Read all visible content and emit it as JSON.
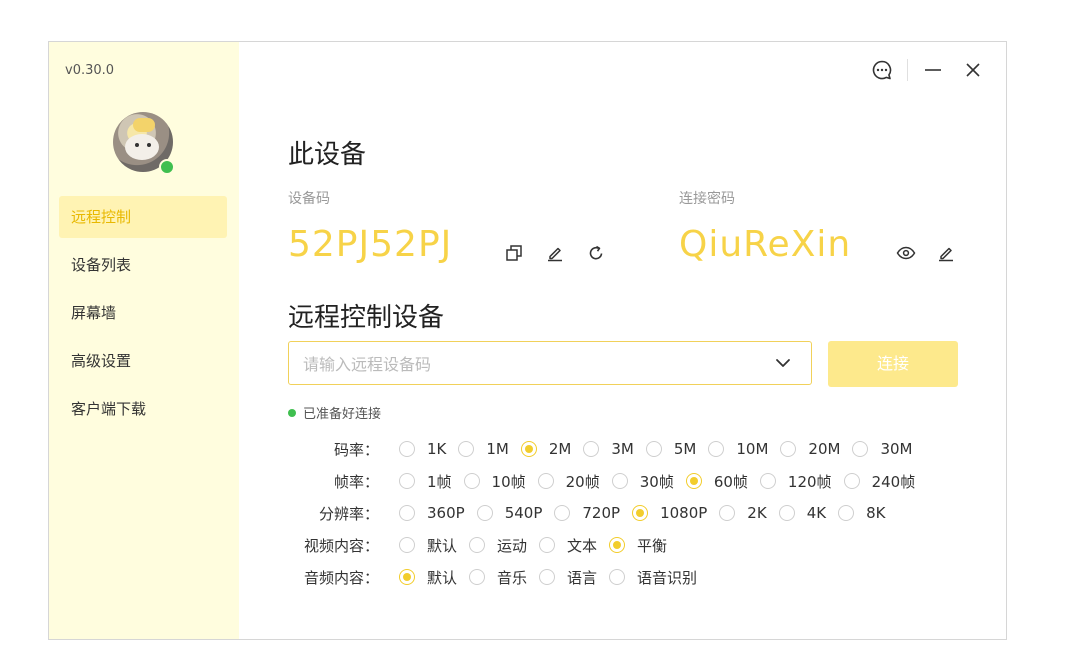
{
  "app": {
    "version": "v0.30.0"
  },
  "icons": {
    "feedback": "chat-bubble-icon",
    "minimize": "minimize-icon",
    "close": "close-icon",
    "copy": "copy-icon",
    "edit": "edit-icon",
    "refresh": "refresh-icon",
    "view": "eye-icon",
    "dropdown": "chevron-down-icon"
  },
  "colors": {
    "accent": "#f7d348",
    "sidebar": "#fffdde",
    "online": "#3fbf4f",
    "connect_button": "#fde98c"
  },
  "sidebar": {
    "items": [
      {
        "label": "远程控制",
        "active": true
      },
      {
        "label": "设备列表",
        "active": false
      },
      {
        "label": "屏幕墙",
        "active": false
      },
      {
        "label": "高级设置",
        "active": false
      },
      {
        "label": "客户端下载",
        "active": false
      }
    ]
  },
  "this_device": {
    "title": "此设备",
    "device_code_label": "设备码",
    "device_code": "52PJ52PJ",
    "password_label": "连接密码",
    "password": "QiuReXin"
  },
  "remote": {
    "title": "远程控制设备",
    "input_placeholder": "请输入远程设备码",
    "input_value": "",
    "connect_label": "连接",
    "status": "已准备好连接"
  },
  "options": [
    {
      "label": "码率：",
      "choices": [
        "1K",
        "1M",
        "2M",
        "3M",
        "5M",
        "10M",
        "20M",
        "30M"
      ],
      "selected": 2
    },
    {
      "label": "帧率：",
      "choices": [
        "1帧",
        "10帧",
        "20帧",
        "30帧",
        "60帧",
        "120帧",
        "240帧"
      ],
      "selected": 4
    },
    {
      "label": "分辨率：",
      "choices": [
        "360P",
        "540P",
        "720P",
        "1080P",
        "2K",
        "4K",
        "8K"
      ],
      "selected": 3
    },
    {
      "label": "视频内容：",
      "choices": [
        "默认",
        "运动",
        "文本",
        "平衡"
      ],
      "selected": 3
    },
    {
      "label": "音频内容：",
      "choices": [
        "默认",
        "音乐",
        "语言",
        "语音识别"
      ],
      "selected": 0
    }
  ]
}
